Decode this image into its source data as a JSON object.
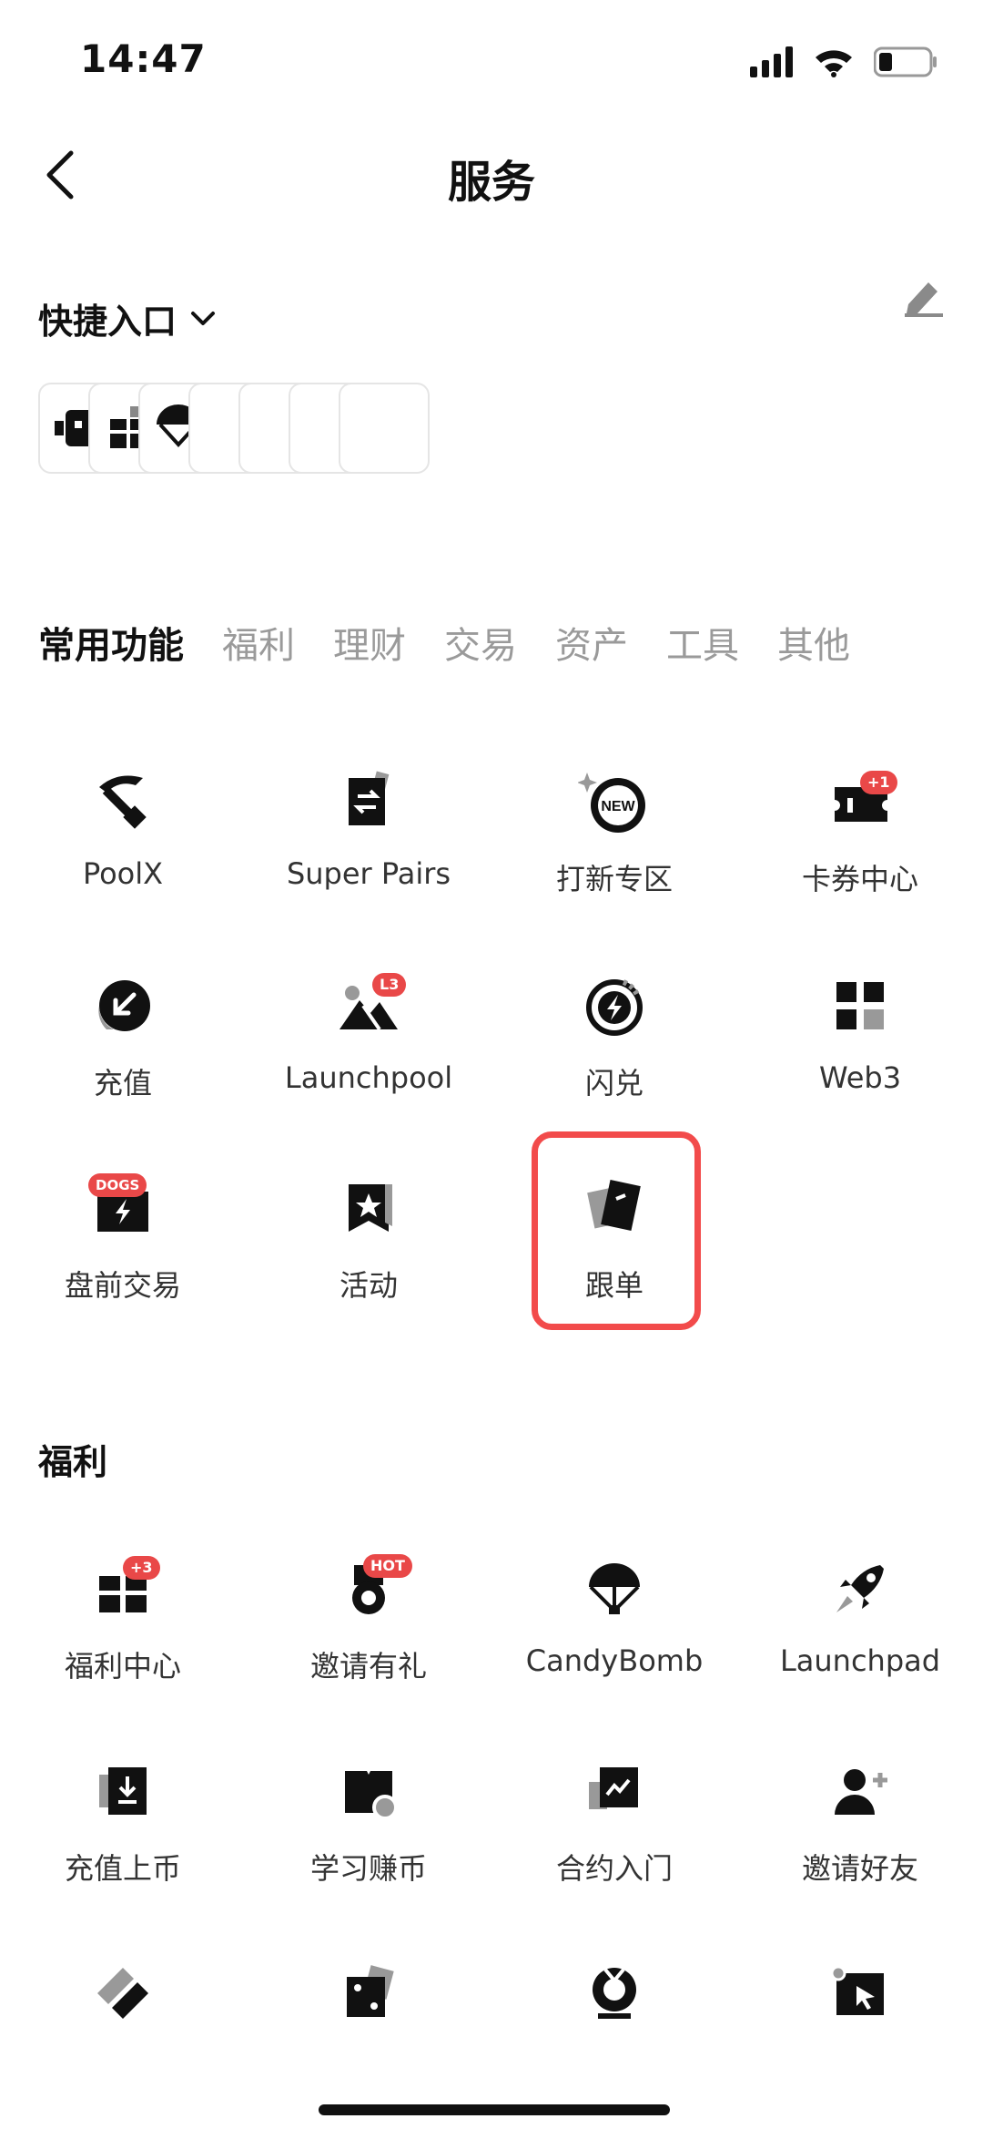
{
  "status": {
    "time": "14:47"
  },
  "header": {
    "title": "服务"
  },
  "quick_entry": {
    "title": "快捷入口"
  },
  "tabs": [
    {
      "label": "常用功能",
      "active": true
    },
    {
      "label": "福利",
      "active": false
    },
    {
      "label": "理财",
      "active": false
    },
    {
      "label": "交易",
      "active": false
    },
    {
      "label": "资产",
      "active": false
    },
    {
      "label": "工具",
      "active": false
    },
    {
      "label": "其他",
      "active": false
    }
  ],
  "common": {
    "items": [
      {
        "label": "PoolX",
        "icon": "pickaxe-icon"
      },
      {
        "label": "Super Pairs",
        "icon": "swap-card-icon"
      },
      {
        "label": "打新专区",
        "icon": "new-badge-icon"
      },
      {
        "label": "卡券中心",
        "icon": "coupon-icon",
        "badge": "+1"
      },
      {
        "label": "充值",
        "icon": "deposit-arrow-icon"
      },
      {
        "label": "Launchpool",
        "icon": "mountain-icon",
        "badge": "L3"
      },
      {
        "label": "闪兑",
        "icon": "flash-icon"
      },
      {
        "label": "Web3",
        "icon": "web3-squares-icon"
      },
      {
        "label": "盘前交易",
        "icon": "premarket-icon",
        "badge": "DOGS"
      },
      {
        "label": "活动",
        "icon": "star-flag-icon"
      },
      {
        "label": "跟单",
        "icon": "copy-trade-icon"
      }
    ]
  },
  "benefits": {
    "title": "福利",
    "items": [
      {
        "label": "福利中心",
        "icon": "gift-icon",
        "badge": "+3"
      },
      {
        "label": "邀请有礼",
        "icon": "medal-icon",
        "badge": "HOT"
      },
      {
        "label": "CandyBomb",
        "icon": "parachute-icon"
      },
      {
        "label": "Launchpad",
        "icon": "rocket-icon"
      },
      {
        "label": "充值上币",
        "icon": "download-card-icon"
      },
      {
        "label": "学习赚币",
        "icon": "book-coin-icon"
      },
      {
        "label": "合约入门",
        "icon": "chart-card-icon"
      },
      {
        "label": "邀请好友",
        "icon": "add-user-icon"
      },
      {
        "label": "",
        "icon": "ticket-icon"
      },
      {
        "label": "",
        "icon": "dice-icon"
      },
      {
        "label": "",
        "icon": "award-icon"
      },
      {
        "label": "",
        "icon": "cursor-card-icon"
      }
    ]
  }
}
